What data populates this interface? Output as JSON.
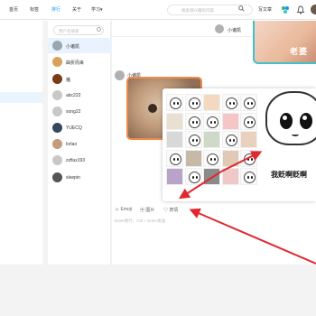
{
  "topbar": {
    "nav": [
      {
        "label": "首页",
        "active": false
      },
      {
        "label": "标签",
        "active": false
      },
      {
        "label": "排行",
        "active": true
      },
      {
        "label": "关于",
        "active": false
      },
      {
        "label": "学习▾",
        "active": false
      }
    ],
    "search_placeholder": "搜索感兴趣的内容",
    "write_label": "写文章",
    "icons": [
      "search-icon",
      "pinwheel-icon",
      "bell-icon",
      "avatar"
    ]
  },
  "contacts": {
    "search_placeholder": "用户名搜索",
    "items": [
      {
        "name": "小诸凯",
        "active": true,
        "color": "#9aa6b1"
      },
      {
        "name": "曲折而来",
        "active": false,
        "color": "#d9a15c"
      },
      {
        "name": "猪",
        "active": false,
        "color": "#7b3a18"
      },
      {
        "name": "abc222",
        "active": false,
        "color": "#c8c8c8"
      },
      {
        "name": "song22",
        "active": false,
        "color": "#c8c8c8"
      },
      {
        "name": "YUECQ",
        "active": false,
        "color": "#34495e"
      },
      {
        "name": "lorlao",
        "active": false,
        "color": "#c49a7a"
      },
      {
        "name": "zzflux193",
        "active": false,
        "color": "#c8c8c8"
      },
      {
        "name": "sleepin",
        "active": false,
        "color": "#555555"
      }
    ]
  },
  "chat": {
    "title": "小诸凯",
    "prev_image_caption": "老婆",
    "sender_name": "小诸凯",
    "preview_caption": "我贬啊贬啊"
  },
  "toolbar": {
    "emoji_label": "Emoji",
    "image_label": "图片",
    "sticker_label": "表情",
    "hint": "Enter换行，Ctrl + Enter发送"
  },
  "colors": {
    "accent": "#1890ff",
    "arrow": "#e0282e",
    "image_border": "#f08a4b",
    "prev_border": "#3fc1c9"
  }
}
